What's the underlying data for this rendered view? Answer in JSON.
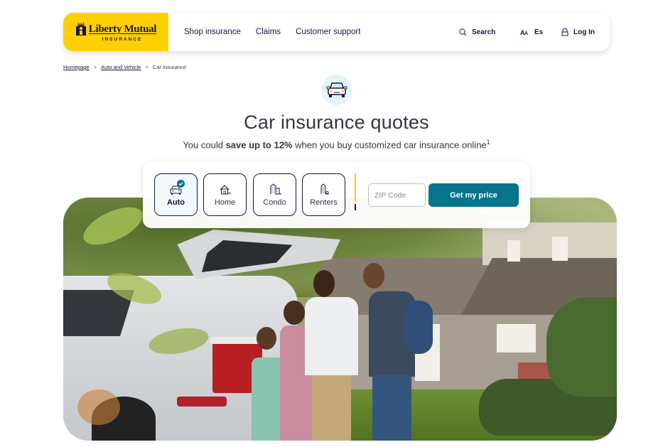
{
  "header": {
    "logo": {
      "brand": "Liberty Mutual",
      "sub": "INSURANCE",
      "brand_color": "#ffd000"
    },
    "nav": [
      "Shop insurance",
      "Claims",
      "Customer support"
    ],
    "utilities": {
      "search": {
        "label": "Search",
        "icon": "search-icon"
      },
      "language": {
        "label": "Es",
        "icon": "text-size-icon"
      },
      "login": {
        "label": "Log In",
        "icon": "lock-icon"
      }
    }
  },
  "breadcrumb": {
    "items": [
      "Homepage",
      "Auto and Vehicle",
      "Car Insurance"
    ],
    "separator": ">"
  },
  "hero": {
    "icon": "car-icon",
    "title": "Car insurance quotes",
    "subtitle_pre": "You could ",
    "subtitle_bold": "save up to 12%",
    "subtitle_post": " when you buy customized car insurance online",
    "footnote": "1"
  },
  "quote": {
    "products": [
      {
        "label": "Auto",
        "icon": "car-icon",
        "selected": true
      },
      {
        "label": "Home",
        "icon": "house-icon",
        "selected": false
      },
      {
        "label": "Condo",
        "icon": "condo-building-icon",
        "selected": false
      },
      {
        "label": "Renters",
        "icon": "renters-building-icon",
        "selected": false
      }
    ],
    "zip": {
      "placeholder": "ZIP Code",
      "value": ""
    },
    "cta": "Get my price",
    "accent": "#06748c"
  },
  "photo": {
    "alt": "Family loading a cooler into the back of an SUV in front of a house"
  }
}
